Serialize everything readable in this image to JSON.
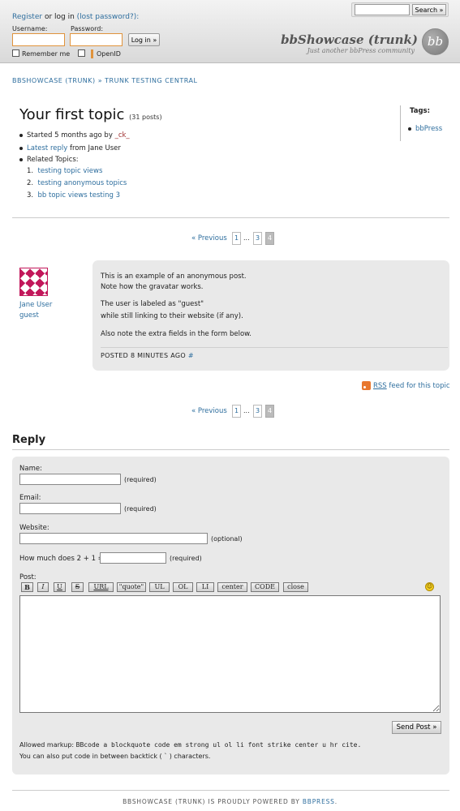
{
  "header": {
    "register_link": "Register",
    "or_login_text": "or log in",
    "lost_password_link": "(lost password?):",
    "username_label": "Username:",
    "password_label": "Password:",
    "login_button": "Log in »",
    "remember_label": "Remember me",
    "openid_label": "OpenID",
    "search_placeholder": "",
    "search_button": "Search »",
    "site_title": "bbShowcase (trunk)",
    "site_tagline": "Just another bbPress community",
    "logo_text": "bb"
  },
  "breadcrumb": {
    "home": "BBSHOWCASE (TRUNK)",
    "separator": "»",
    "forum": "TRUNK TESTING CENTRAL"
  },
  "topic": {
    "title": "Your first topic",
    "post_count": "(31 posts)",
    "started_text": "Started 5 months ago by",
    "started_user": "_ck_",
    "latest_reply_link": "Latest reply",
    "latest_reply_from": "from Jane User",
    "related_label": "Related Topics:",
    "related": [
      {
        "num": "1.",
        "title": "testing topic views"
      },
      {
        "num": "2.",
        "title": "testing anonymous topics"
      },
      {
        "num": "3.",
        "title": "bb topic views testing 3"
      }
    ]
  },
  "tags": {
    "label": "Tags:",
    "items": [
      "bbPress"
    ]
  },
  "pagination": {
    "previous": "« Previous",
    "pages": [
      "1",
      "...",
      "3",
      "4"
    ]
  },
  "post": {
    "author": "Jane User",
    "role": "guest",
    "lines": [
      "This is an example of an anonymous post.",
      "Note how the gravatar works.",
      "The user is labeled as \"guest\"",
      "while still linking to their website (if any).",
      "Also note the extra fields in the form below."
    ],
    "posted": "POSTED 8 MINUTES AGO",
    "permalink": "#"
  },
  "rss": {
    "link": "RSS",
    "text": "feed for this topic"
  },
  "reply": {
    "heading": "Reply",
    "name_label": "Name:",
    "name_hint": "(required)",
    "email_label": "Email:",
    "email_hint": "(required)",
    "website_label": "Website:",
    "website_hint": "(optional)",
    "captcha_label": "How much does 2 + 1 =",
    "captcha_hint": "(required)",
    "post_label": "Post:",
    "toolbar": [
      "B",
      "I",
      "U",
      "S",
      "URL",
      "\"quote\"",
      "UL",
      "OL",
      "LI",
      "center",
      "CODE",
      "close"
    ],
    "send_button": "Send Post »",
    "allowed_label": "Allowed markup:",
    "allowed_tags": "BBcode a blockquote code em strong ul ol li font strike center u hr cite.",
    "backtick_note": "You can also put code in between backtick ( ` ) characters."
  },
  "footer": {
    "text_before": "BBSHOWCASE (TRUNK) IS PROUDLY POWERED BY",
    "link": "BBPRESS",
    "text_after": "."
  }
}
